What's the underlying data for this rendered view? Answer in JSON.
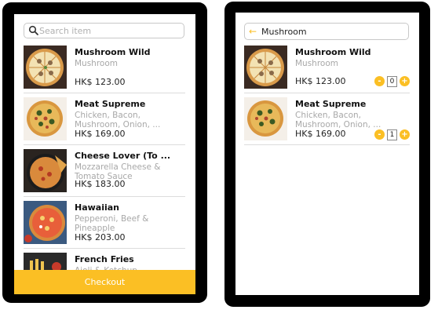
{
  "left": {
    "search": {
      "placeholder": "Search item",
      "value": ""
    },
    "items": [
      {
        "name": "Mushroom Wild",
        "desc": "Mushroom",
        "price": "HK$ 123.00"
      },
      {
        "name": "Meat Supreme",
        "desc": "Chicken, Bacon, Mushroom, Onion, ...",
        "price": "HK$ 169.00"
      },
      {
        "name": "Cheese Lover (To ...",
        "desc": "Mozzarella Cheese & Tomato Sauce",
        "price": "HK$ 183.00"
      },
      {
        "name": "Hawaiian",
        "desc": "Pepperoni, Beef & Pineapple",
        "price": "HK$ 203.00"
      },
      {
        "name": "French Fries",
        "desc": "Aioli & Ketchup",
        "price": ""
      }
    ],
    "checkout_label": "Checkout"
  },
  "right": {
    "search": {
      "value": "Mushroom"
    },
    "items": [
      {
        "name": "Mushroom Wild",
        "desc": "Mushroom",
        "price": "HK$ 123.00",
        "qty": "0"
      },
      {
        "name": "Meat Supreme",
        "desc": "Chicken, Bacon, Mushroom, Onion, ...",
        "price": "HK$ 169.00",
        "qty": "1"
      }
    ],
    "minus_label": "-",
    "plus_label": "+"
  },
  "colors": {
    "accent": "#fbbf24",
    "muted_text": "#a8a8a8",
    "divider": "#dcdcdc"
  },
  "icons": {
    "search": "search-icon",
    "back": "back-arrow-icon"
  }
}
